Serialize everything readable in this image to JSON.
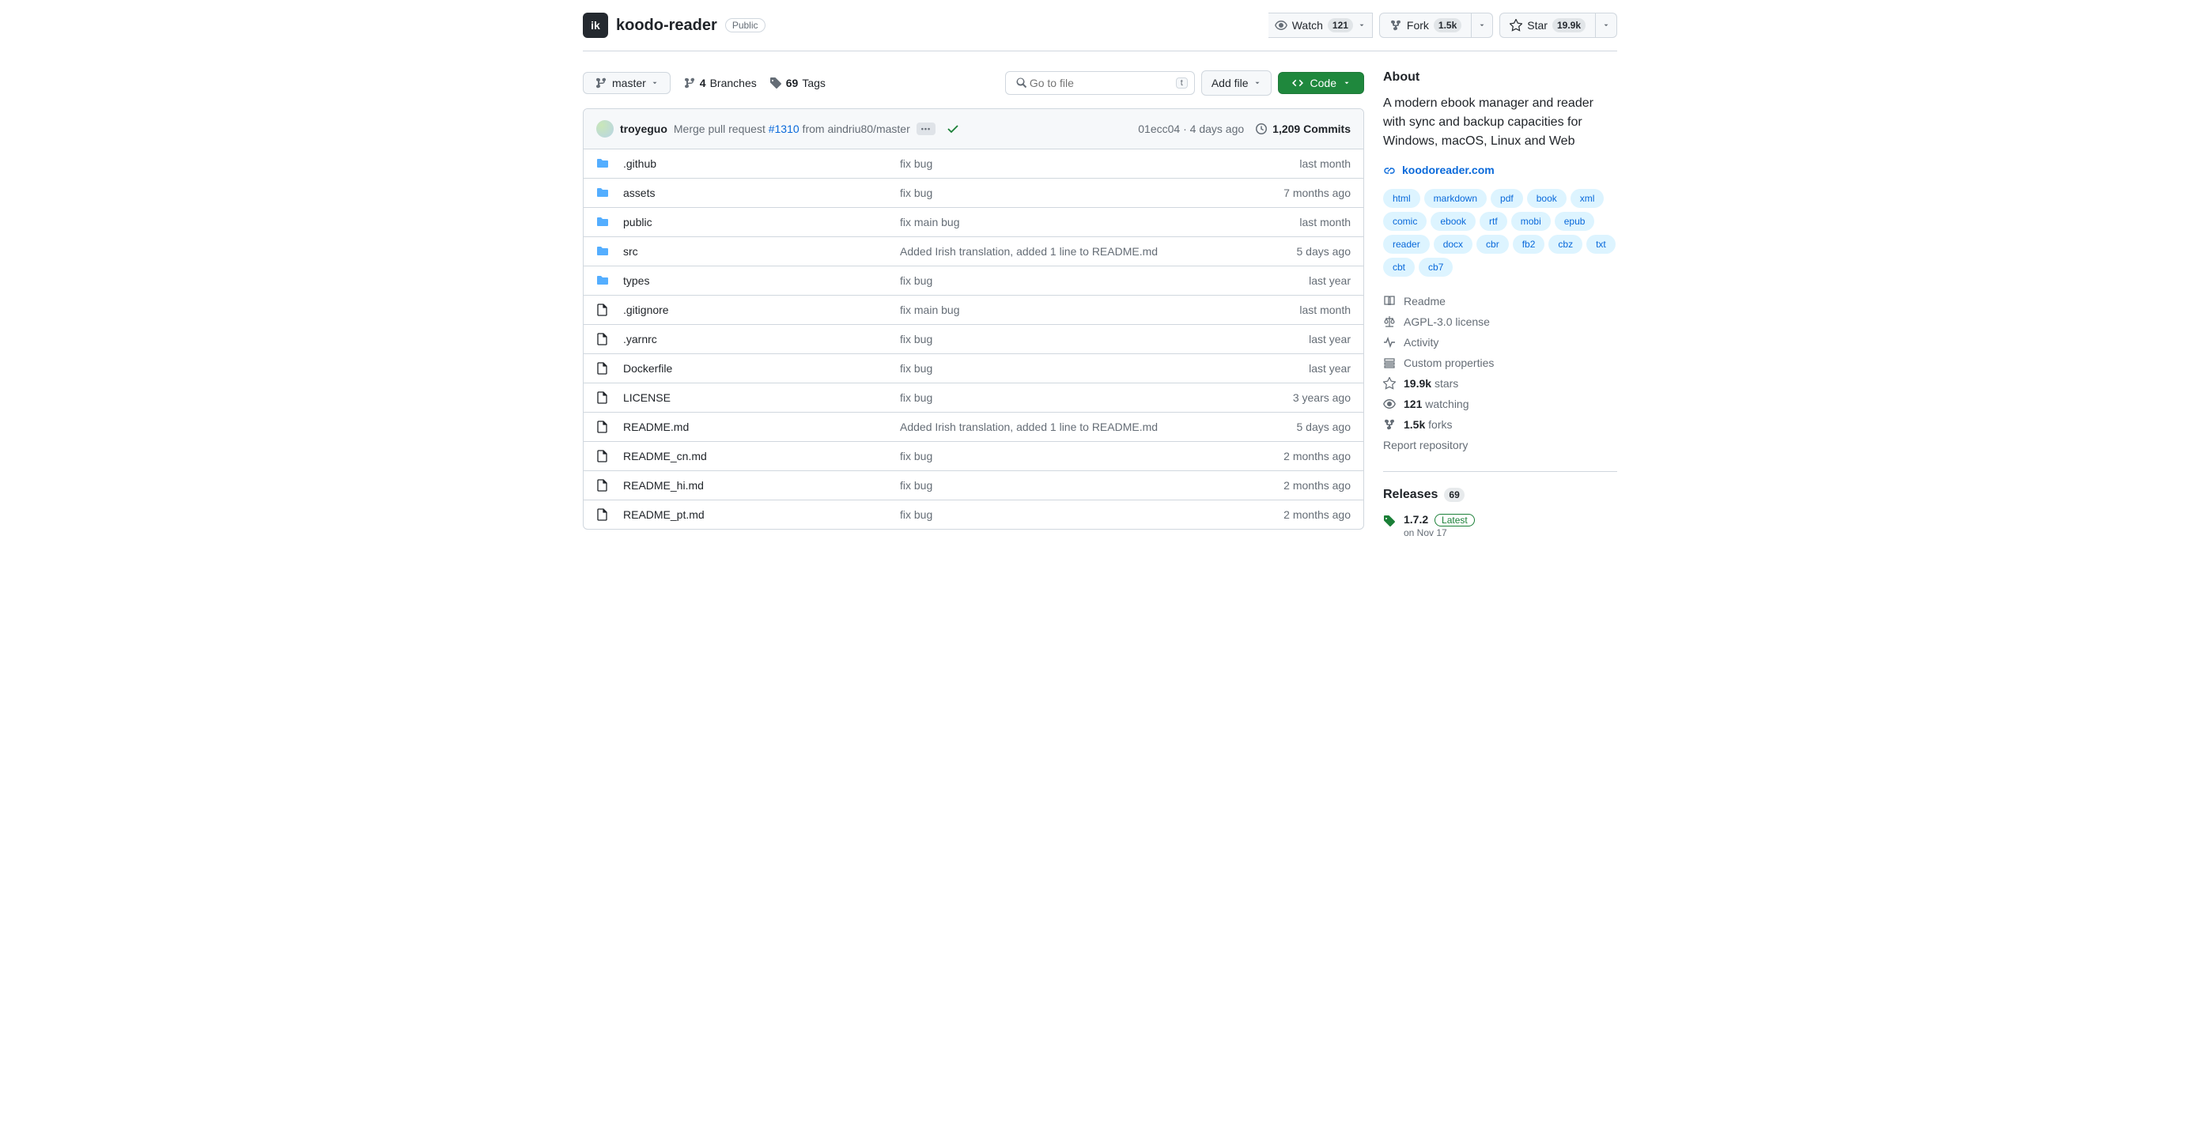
{
  "repo": {
    "name": "koodo-reader",
    "visibility": "Public"
  },
  "actions": {
    "watch": {
      "label": "Watch",
      "count": "121"
    },
    "fork": {
      "label": "Fork",
      "count": "1.5k"
    },
    "star": {
      "label": "Star",
      "count": "19.9k"
    }
  },
  "file_nav": {
    "branch": "master",
    "branches_count": "4",
    "branches_label": "Branches",
    "tags_count": "69",
    "tags_label": "Tags",
    "go_to_file": "Go to file",
    "key_hint": "t",
    "add_file": "Add file",
    "code": "Code"
  },
  "commit": {
    "author": "troyeguo",
    "msg_prefix": "Merge pull request ",
    "msg_link": "#1310",
    "msg_suffix": " from aindriu80/master",
    "sha": "01ecc04",
    "date": "4 days ago",
    "commits_count": "1,209",
    "commits_label": "Commits"
  },
  "files": [
    {
      "type": "dir",
      "name": ".github",
      "msg": "fix bug",
      "date": "last month"
    },
    {
      "type": "dir",
      "name": "assets",
      "msg": "fix bug",
      "date": "7 months ago"
    },
    {
      "type": "dir",
      "name": "public",
      "msg": "fix main bug",
      "date": "last month"
    },
    {
      "type": "dir",
      "name": "src",
      "msg": "Added Irish translation, added 1 line to README.md",
      "date": "5 days ago"
    },
    {
      "type": "dir",
      "name": "types",
      "msg": "fix bug",
      "date": "last year"
    },
    {
      "type": "file",
      "name": ".gitignore",
      "msg": "fix main bug",
      "date": "last month"
    },
    {
      "type": "file",
      "name": ".yarnrc",
      "msg": "fix bug",
      "date": "last year"
    },
    {
      "type": "file",
      "name": "Dockerfile",
      "msg": "fix bug",
      "date": "last year"
    },
    {
      "type": "file",
      "name": "LICENSE",
      "msg": "fix bug",
      "date": "3 years ago"
    },
    {
      "type": "file",
      "name": "README.md",
      "msg": "Added Irish translation, added 1 line to README.md",
      "date": "5 days ago"
    },
    {
      "type": "file",
      "name": "README_cn.md",
      "msg": "fix bug",
      "date": "2 months ago"
    },
    {
      "type": "file",
      "name": "README_hi.md",
      "msg": "fix bug",
      "date": "2 months ago"
    },
    {
      "type": "file",
      "name": "README_pt.md",
      "msg": "fix bug",
      "date": "2 months ago"
    }
  ],
  "about": {
    "heading": "About",
    "description": "A modern ebook manager and reader with sync and backup capacities for Windows, macOS, Linux and Web",
    "website": "koodoreader.com",
    "topics": [
      "html",
      "markdown",
      "pdf",
      "book",
      "xml",
      "comic",
      "ebook",
      "rtf",
      "mobi",
      "epub",
      "reader",
      "docx",
      "cbr",
      "fb2",
      "cbz",
      "txt",
      "cbt",
      "cb7"
    ],
    "readme": "Readme",
    "license": "AGPL-3.0 license",
    "activity": "Activity",
    "custom_props": "Custom properties",
    "stars_count": "19.9k",
    "stars_label": "stars",
    "watching_count": "121",
    "watching_label": "watching",
    "forks_count": "1.5k",
    "forks_label": "forks",
    "report": "Report repository"
  },
  "releases": {
    "heading": "Releases",
    "count": "69",
    "latest_version": "1.7.2",
    "latest_badge": "Latest",
    "date": "on Nov 17"
  }
}
